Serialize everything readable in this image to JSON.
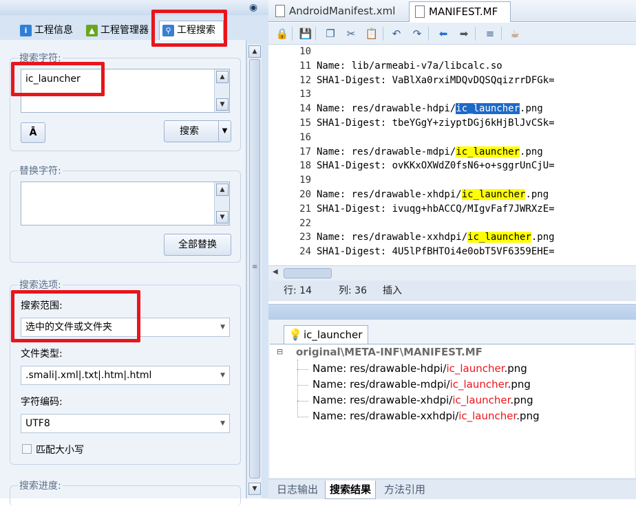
{
  "left_tabs": [
    {
      "label": "工程信息",
      "icon": "info-icon"
    },
    {
      "label": "工程管理器",
      "icon": "android-icon"
    },
    {
      "label": "工程搜索",
      "icon": "search-icon"
    }
  ],
  "search": {
    "section_label": "搜索字符:",
    "value": "ic_launcher",
    "button_label": "搜索"
  },
  "replace": {
    "section_label": "替换字符:",
    "value": "",
    "button_label": "全部替换"
  },
  "options": {
    "section_label": "搜索选项:",
    "scope_label": "搜索范围:",
    "scope_value": "选中的文件或文件夹",
    "filetype_label": "文件类型:",
    "filetype_value": ".smali|.xml|.txt|.htm|.html",
    "encoding_label": "字符编码:",
    "encoding_value": "UTF8",
    "match_case_label": "匹配大小写"
  },
  "progress": {
    "section_label": "搜索进度:"
  },
  "file_tabs": [
    {
      "label": "AndroidManifest.xml"
    },
    {
      "label": "MANIFEST.MF"
    }
  ],
  "editor_lines": [
    {
      "num": "10",
      "pre": "",
      "match": "",
      "post": ""
    },
    {
      "num": "11",
      "pre": "Name: lib/armeabi-v7a/libcalc.so",
      "match": "",
      "post": ""
    },
    {
      "num": "12",
      "pre": "SHA1-Digest: VaBlXa0rxiMDQvDQSQqizrrDFGk=",
      "match": "",
      "post": ""
    },
    {
      "num": "13",
      "pre": "",
      "match": "",
      "post": ""
    },
    {
      "num": "14",
      "pre": "Name: res/drawable-hdpi/",
      "match": "ic_launcher",
      "post": ".png"
    },
    {
      "num": "15",
      "pre": "SHA1-Digest: tbeYGgY+ziyptDGj6kHjBlJvCSk=",
      "match": "",
      "post": ""
    },
    {
      "num": "16",
      "pre": "",
      "match": "",
      "post": ""
    },
    {
      "num": "17",
      "pre": "Name: res/drawable-mdpi/",
      "match": "ic_launcher",
      "post": ".png"
    },
    {
      "num": "18",
      "pre": "SHA1-Digest: ovKKxOXWdZ0fsN6+o+sggrUnCjU=",
      "match": "",
      "post": ""
    },
    {
      "num": "19",
      "pre": "",
      "match": "",
      "post": ""
    },
    {
      "num": "20",
      "pre": "Name: res/drawable-xhdpi/",
      "match": "ic_launcher",
      "post": ".png"
    },
    {
      "num": "21",
      "pre": "SHA1-Digest: ivuqg+hbACCQ/MIgvFaf7JWRXzE=",
      "match": "",
      "post": ""
    },
    {
      "num": "22",
      "pre": "",
      "match": "",
      "post": ""
    },
    {
      "num": "23",
      "pre": "Name: res/drawable-xxhdpi/",
      "match": "ic_launcher",
      "post": ".png"
    },
    {
      "num": "24",
      "pre": "SHA1-Digest: 4U5lPfBHTOi4e0obT5VF6359EHE=",
      "match": "",
      "post": ""
    }
  ],
  "status": {
    "row_label": "行: 14",
    "col_label": "列: 36",
    "mode_label": "插入"
  },
  "results": {
    "tab_label": "ic_launcher",
    "root": "original\\META-INF\\MANIFEST.MF",
    "items": [
      {
        "pre": "Name: res/drawable-hdpi/",
        "match": "ic_launcher",
        "post": ".png"
      },
      {
        "pre": "Name: res/drawable-mdpi/",
        "match": "ic_launcher",
        "post": ".png"
      },
      {
        "pre": "Name: res/drawable-xhdpi/",
        "match": "ic_launcher",
        "post": ".png"
      },
      {
        "pre": "Name: res/drawable-xxhdpi/",
        "match": "ic_launcher",
        "post": ".png"
      }
    ]
  },
  "bottom_tabs": [
    {
      "label": "日志输出"
    },
    {
      "label": "搜索结果"
    },
    {
      "label": "方法引用"
    }
  ],
  "colors": {
    "highlight": "#ffff00",
    "selection": "#1b6ac9",
    "annotation": "#e8151b",
    "match_text": "#e8151b"
  }
}
